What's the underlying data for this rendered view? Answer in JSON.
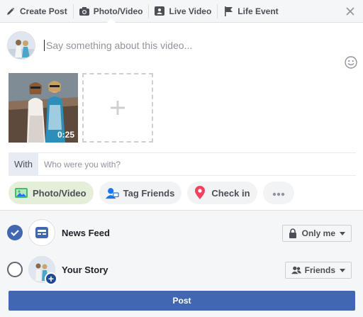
{
  "tabs": [
    {
      "label": "Create Post",
      "icon": "pencil-icon",
      "active": false
    },
    {
      "label": "Photo/Video",
      "icon": "camera-icon",
      "active": true
    },
    {
      "label": "Live Video",
      "icon": "live-video-icon",
      "active": false
    },
    {
      "label": "Life Event",
      "icon": "flag-icon",
      "active": false
    }
  ],
  "composer": {
    "placeholder": "Say something about this video...",
    "video_duration": "0:25"
  },
  "with": {
    "label": "With",
    "placeholder": "Who were you with?"
  },
  "actions": [
    {
      "label": "Photo/Video",
      "icon": "photo-icon",
      "active": true
    },
    {
      "label": "Tag Friends",
      "icon": "tag-friends-icon",
      "active": false
    },
    {
      "label": "Check in",
      "icon": "location-pin-icon",
      "active": false
    },
    {
      "label": "",
      "icon": "more-icon",
      "active": false
    }
  ],
  "destinations": [
    {
      "label": "News Feed",
      "checked": true,
      "privacy": "Only me",
      "privacy_icon": "lock-icon"
    },
    {
      "label": "Your Story",
      "checked": false,
      "privacy": "Friends",
      "privacy_icon": "friends-icon"
    }
  ],
  "post_button": "Post",
  "colors": {
    "brand": "#4267b2",
    "check": "#4267b2",
    "photo_green": "#45bd62",
    "pin_red": "#f3425f"
  }
}
